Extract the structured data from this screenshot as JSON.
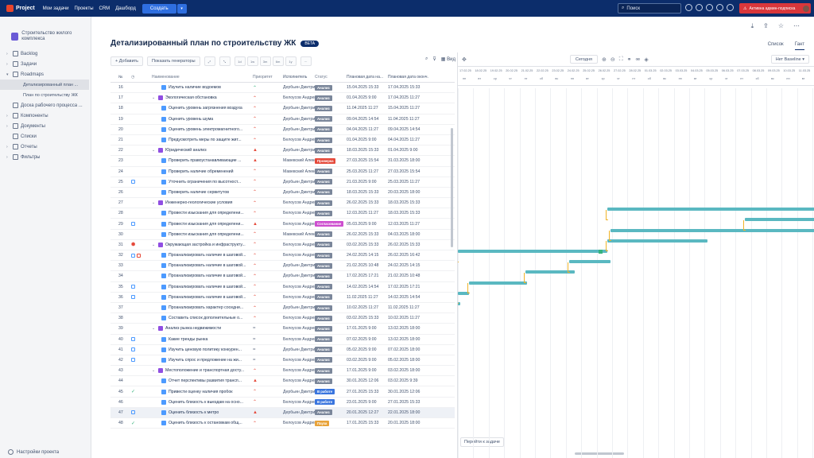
{
  "app": {
    "name": "Project",
    "nav": [
      "Мои задачи",
      "Проекты",
      "CRM",
      "Дашборд"
    ],
    "create": "Создать",
    "search_placeholder": "Поиск",
    "trial": "Активна админ-подписка"
  },
  "sidebar": {
    "project_name": "Строительство жилого комплекса",
    "items": [
      {
        "label": "Backlog"
      },
      {
        "label": "Задачи"
      },
      {
        "label": "Roadmaps"
      }
    ],
    "roadmap_children": [
      "Детализированный план ...",
      "План по строительству ЖК"
    ],
    "items2": [
      {
        "label": "Доска рабочего процесса ..."
      },
      {
        "label": "Компоненты"
      },
      {
        "label": "Документы"
      },
      {
        "label": "Списки"
      },
      {
        "label": "Отчеты"
      },
      {
        "label": "Фильтры"
      }
    ],
    "settings": "Настройки проекта"
  },
  "page": {
    "title": "Детализированный план по строительству ЖК",
    "badge": "BETA",
    "tabs": [
      "Список",
      "Гант"
    ],
    "add": "+ Добавить",
    "generators": "Показать генераторы",
    "zoom": [
      "1d",
      "1w",
      "3m",
      "6m",
      "1y"
    ],
    "view": "Вид"
  },
  "columns": [
    "№",
    "",
    "Наименование",
    "Приоритет",
    "Исполнитель",
    "Статус",
    "Плановая дата на...",
    "Плановая дата оконч."
  ],
  "status_colors": {
    "Анализ": "#7a869a",
    "Проверка": "#e5493a",
    "Согласование": "#cd4ecf",
    "В работе": "#3a75de",
    "Пауза": "#e8a33a"
  },
  "rows": [
    {
      "n": "16",
      "ic": "",
      "epic": false,
      "sub": true,
      "name": "Изучить наличие водоемов",
      "pri": "~",
      "user": "Дербьин Дмитрий",
      "st": "Анализ",
      "s": "15.04.2025 15:33",
      "e": "17.04.2025 15:33"
    },
    {
      "n": "17",
      "ic": "",
      "epic": true,
      "sub": false,
      "name": "Экологическая обстановка",
      "pri": "^",
      "user": "Белоусов Андрей",
      "st": "Анализ",
      "s": "01.04.2025 9:00",
      "e": "17.04.2025 11:27"
    },
    {
      "n": "18",
      "ic": "",
      "epic": false,
      "sub": true,
      "name": "Оценить уровень загрязнения воздуха",
      "pri": "^",
      "user": "Дербьин Дмитрий",
      "st": "Анализ",
      "s": "11.04.2025 11:27",
      "e": "15.04.2025 11:27"
    },
    {
      "n": "19",
      "ic": "",
      "epic": false,
      "sub": true,
      "name": "Оценить уровень шума",
      "pri": "^",
      "user": "Дербьин Дмитрий",
      "st": "Анализ",
      "s": "09.04.2025 14:54",
      "e": "11.04.2025 11:27"
    },
    {
      "n": "20",
      "ic": "",
      "epic": false,
      "sub": true,
      "name": "Оценить уровень электромагнитного...",
      "pri": "^",
      "user": "Дербьин Дмитрий",
      "st": "Анализ",
      "s": "04.04.2025 11:27",
      "e": "09.04.2025 14:54"
    },
    {
      "n": "21",
      "ic": "",
      "epic": false,
      "sub": true,
      "name": "Предусмотреть меры по защите жит...",
      "pri": "^",
      "user": "Белоусов Андрей",
      "st": "Анализ",
      "s": "01.04.2025 9:00",
      "e": "04.04.2025 11:27"
    },
    {
      "n": "22",
      "ic": "",
      "epic": true,
      "sub": false,
      "name": "Юридический анализ",
      "pri": "!",
      "user": "Дербьин Дмитрий",
      "st": "Анализ",
      "s": "18.03.2025 15:33",
      "e": "01.04.2025 9:00"
    },
    {
      "n": "23",
      "ic": "",
      "epic": false,
      "sub": true,
      "name": "Проверить правоустанавливающие ...",
      "pri": "!",
      "user": "Мавевский Алексей",
      "st": "Проверка",
      "s": "27.03.2025 15:54",
      "e": "31.03.2025 18:00"
    },
    {
      "n": "24",
      "ic": "",
      "epic": false,
      "sub": true,
      "name": "Проверить наличие обременений",
      "pri": "^",
      "user": "Мавевский Алексей",
      "st": "Анализ",
      "s": "25.03.2025 11:27",
      "e": "27.03.2025 15:54"
    },
    {
      "n": "25",
      "ic": "cal",
      "epic": false,
      "sub": true,
      "name": "Уточнить ограничения по высотност...",
      "pri": "^",
      "user": "Дербьин Дмитрий",
      "st": "Анализ",
      "s": "21.03.2025 9:00",
      "e": "25.03.2025 11:27"
    },
    {
      "n": "26",
      "ic": "",
      "epic": false,
      "sub": true,
      "name": "Проверить наличие сервитутов",
      "pri": "^",
      "user": "Дербьин Дмитрий",
      "st": "Анализ",
      "s": "18.03.2025 15:33",
      "e": "20.03.2025 18:00"
    },
    {
      "n": "27",
      "ic": "",
      "epic": true,
      "sub": false,
      "name": "Инженерно-геологические условия",
      "pri": "^",
      "user": "Белоусов Андрей",
      "st": "Анализ",
      "s": "26.02.2025 15:33",
      "e": "18.03.2025 15:33"
    },
    {
      "n": "28",
      "ic": "",
      "epic": false,
      "sub": true,
      "name": "Провести изыскания для определени...",
      "pri": "^",
      "user": "Белоусов Андрей",
      "st": "Анализ",
      "s": "12.03.2025 11:27",
      "e": "18.03.2025 15:33"
    },
    {
      "n": "29",
      "ic": "cal",
      "epic": false,
      "sub": true,
      "name": "Провести изыскания для определени...",
      "pri": "!",
      "user": "Белоусов Андрей",
      "st": "Согласование",
      "s": "05.03.2025 9:00",
      "e": "12.03.2025 11:27"
    },
    {
      "n": "30",
      "ic": "",
      "epic": false,
      "sub": true,
      "name": "Провести изыскания для определени...",
      "pri": "^",
      "user": "Мавевский Алексей",
      "st": "Анализ",
      "s": "26.02.2025 15:33",
      "e": "04.03.2025 18:00"
    },
    {
      "n": "31",
      "ic": "bug",
      "epic": true,
      "sub": false,
      "name": "Окружающая застройка и инфраструкту...",
      "pri": "^",
      "user": "Белоусов Андрей",
      "st": "Анализ",
      "s": "03.02.2025 15:33",
      "e": "26.02.2025 15:33"
    },
    {
      "n": "32",
      "ic": "cal2",
      "epic": false,
      "sub": true,
      "name": "Проанализировать наличие в шаговой...",
      "pri": "^",
      "user": "Белоусов Андрей",
      "st": "Анализ",
      "s": "24.02.2025 14:15",
      "e": "26.02.2025 16:42"
    },
    {
      "n": "33",
      "ic": "",
      "epic": false,
      "sub": true,
      "name": "Проанализировать наличие в шаговой...",
      "pri": "^",
      "user": "Дербьин Дмитрий",
      "st": "Анализ",
      "s": "21.02.2025 10:48",
      "e": "24.02.2025 14:15"
    },
    {
      "n": "34",
      "ic": "",
      "epic": false,
      "sub": true,
      "name": "Проанализировать наличие в шаговой...",
      "pri": "^",
      "user": "Дербьин Дмитрий",
      "st": "Анализ",
      "s": "17.02.2025 17:21",
      "e": "21.02.2025 10:48"
    },
    {
      "n": "35",
      "ic": "cal",
      "epic": false,
      "sub": true,
      "name": "Проанализировать наличие в шаговой...",
      "pri": "^",
      "user": "Белоусов Андрей",
      "st": "Анализ",
      "s": "14.02.2025 14:54",
      "e": "17.02.2025 17:21"
    },
    {
      "n": "36",
      "ic": "cal",
      "epic": false,
      "sub": true,
      "name": "Проанализировать наличие в шаговой...",
      "pri": "^",
      "user": "Белоусов Андрей",
      "st": "Анализ",
      "s": "11.02.2025 11:27",
      "e": "14.02.2025 14:54"
    },
    {
      "n": "37",
      "ic": "",
      "epic": false,
      "sub": true,
      "name": "Проанализировать характер соседни...",
      "pri": "^",
      "user": "Дербьин Дмитрий",
      "st": "Анализ",
      "s": "10.02.2025 11:27",
      "e": "11.02.2025 11:27"
    },
    {
      "n": "38",
      "ic": "",
      "epic": false,
      "sub": true,
      "name": "Составить список дополнительные о...",
      "pri": "^",
      "user": "Белоусов Андрей",
      "st": "Анализ",
      "s": "03.02.2025 15:33",
      "e": "10.02.2025 11:27"
    },
    {
      "n": "39",
      "ic": "",
      "epic": true,
      "sub": false,
      "name": "Анализ рынка недвижимости",
      "pri": "=",
      "user": "Белоусов Андрей",
      "st": "Анализ",
      "s": "17.01.2025 9:00",
      "e": "13.02.2025 18:00"
    },
    {
      "n": "40",
      "ic": "cal",
      "epic": false,
      "sub": true,
      "name": "Какие тренды рынка",
      "pri": "=",
      "user": "Белоусов Андрей",
      "st": "Анализ",
      "s": "07.02.2025 9:00",
      "e": "13.02.2025 18:00"
    },
    {
      "n": "41",
      "ic": "cal",
      "epic": false,
      "sub": true,
      "name": "Изучить ценовую политику конкурен...",
      "pri": "=",
      "user": "Дербьин Дмитрий",
      "st": "Анализ",
      "s": "05.02.2025 9:00",
      "e": "07.02.2025 18:00"
    },
    {
      "n": "42",
      "ic": "cal",
      "epic": false,
      "sub": true,
      "name": "Изучить спрос и предложение на жи...",
      "pri": "=",
      "user": "Белоусов Андрей",
      "st": "Анализ",
      "s": "03.02.2025 9:00",
      "e": "05.02.2025 18:00"
    },
    {
      "n": "43",
      "ic": "",
      "epic": true,
      "sub": false,
      "name": "Местоположение и транспортная досту...",
      "pri": "^",
      "user": "Белоусов Андрей",
      "st": "Анализ",
      "s": "17.01.2025 9:00",
      "e": "03.02.2025 18:00"
    },
    {
      "n": "44",
      "ic": "",
      "epic": false,
      "sub": true,
      "name": "Отчет перспективы развития трансп...",
      "pri": "!",
      "user": "Белоусов Андрей",
      "st": "Анализ",
      "s": "30.01.2025 12:06",
      "e": "03.02.2025 9:39"
    },
    {
      "n": "45",
      "ic": "done",
      "epic": false,
      "sub": true,
      "name": "Привести оценку наличия пробок",
      "pri": "^",
      "user": "Дербьин Дмитрий",
      "st": "В работе",
      "s": "27.01.2025 15:33",
      "e": "30.01.2025 12:06"
    },
    {
      "n": "46",
      "ic": "",
      "epic": false,
      "sub": true,
      "name": "Оценить близость к выездам на осно...",
      "pri": "^",
      "user": "Белоусов Андрей",
      "st": "В работе",
      "s": "23.01.2025 9:00",
      "e": "27.01.2025 15:33"
    },
    {
      "n": "47",
      "ic": "cal",
      "epic": false,
      "sub": true,
      "name": "Оценить близость к метро",
      "pri": "!",
      "user": "Дербьин Дмитрий",
      "st": "Анализ",
      "s": "20.01.2025 12:27",
      "e": "22.01.2025 18:00"
    },
    {
      "n": "48",
      "ic": "done",
      "epic": false,
      "sub": true,
      "name": "Оценить близость к остановкам общ...",
      "pri": "^",
      "user": "Белоусов Андрей",
      "st": "Пауза",
      "s": "17.01.2025 15:33",
      "e": "20.01.2025 18:00"
    }
  ],
  "gantt": {
    "today": "Сегодня",
    "baseline": "Нет Baseline",
    "goto": "Перейти к задаче",
    "dates": [
      "17.02.25",
      "18.02.25",
      "19.02.25",
      "20.02.25",
      "21.02.25",
      "22.02.25",
      "23.02.25",
      "24.02.25",
      "25.02.25",
      "26.02.25",
      "27.02.25",
      "28.02.25",
      "01.03.25",
      "02.03.25",
      "03.03.25",
      "04.03.25",
      "05.03.25",
      "06.03.25",
      "07.03.25",
      "08.03.25",
      "09.03.25",
      "10.03.25",
      "11.03.25",
      "12.03.25"
    ],
    "days": [
      "пн",
      "вт",
      "ср",
      "чт",
      "пт",
      "сб",
      "вс",
      "пн",
      "вт",
      "ср",
      "чт",
      "пт",
      "сб",
      "вс",
      "пн",
      "вт",
      "ср",
      "чт",
      "пт",
      "сб",
      "вс",
      "пн",
      "вт",
      "ср"
    ],
    "bars": [
      {
        "row": 11,
        "from": 9.7,
        "to": 25
      },
      {
        "row": 12,
        "from": 18.6,
        "to": 25
      },
      {
        "row": 13,
        "from": 9.9,
        "to": 25
      },
      {
        "row": 14,
        "from": 9.7,
        "to": 16.2
      },
      {
        "row": 15,
        "from": -1,
        "to": 9.7
      },
      {
        "row": 16,
        "from": 7.2,
        "to": 9.9
      },
      {
        "row": 17,
        "from": 4.4,
        "to": 7.6
      },
      {
        "row": 18,
        "from": 0.7,
        "to": 4.5
      },
      {
        "row": 19,
        "from": -1,
        "to": 0.7
      },
      {
        "row": 20,
        "from": -1,
        "to": -0.1
      }
    ]
  }
}
